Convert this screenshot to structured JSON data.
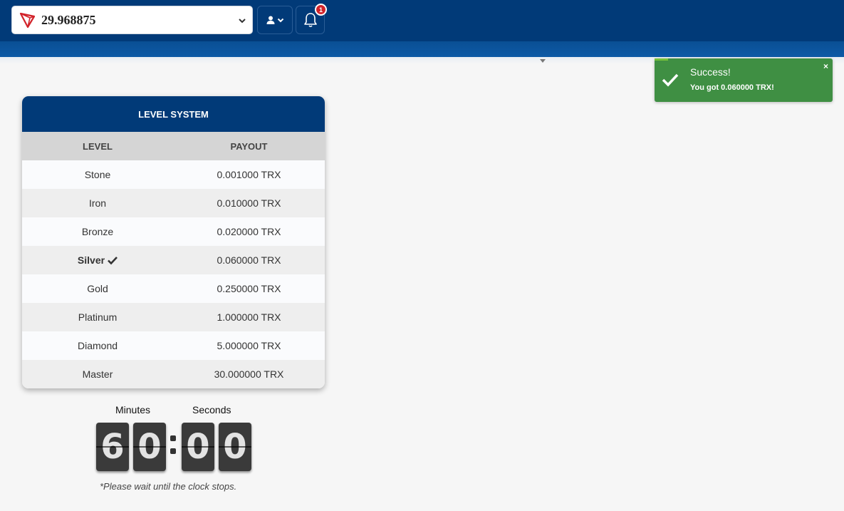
{
  "header": {
    "balance": "29.968875",
    "notification_count": "1",
    "icons": {
      "currency": "tron-icon",
      "user": "user-icon",
      "notifications": "bell-icon"
    }
  },
  "toast": {
    "title": "Success!",
    "message": "You got 0.060000 TRX!",
    "close": "×",
    "color": "#3f8f43"
  },
  "level_system": {
    "title": "LEVEL SYSTEM",
    "columns": [
      "LEVEL",
      "PAYOUT"
    ],
    "rows": [
      {
        "level": "Stone",
        "payout": "0.001000 TRX"
      },
      {
        "level": "Iron",
        "payout": "0.010000 TRX"
      },
      {
        "level": "Bronze",
        "payout": "0.020000 TRX"
      },
      {
        "level": "Silver",
        "payout": "0.060000 TRX",
        "current": true
      },
      {
        "level": "Gold",
        "payout": "0.250000 TRX"
      },
      {
        "level": "Platinum",
        "payout": "1.000000 TRX"
      },
      {
        "level": "Diamond",
        "payout": "5.000000 TRX"
      },
      {
        "level": "Master",
        "payout": "30.000000 TRX"
      }
    ]
  },
  "timer": {
    "minutes_label": "Minutes",
    "seconds_label": "Seconds",
    "digits": [
      "6",
      "0",
      "0",
      "0"
    ],
    "note": "*Please wait until the clock stops."
  },
  "colors": {
    "brand": "#013a78",
    "accent": "#0d5aa6",
    "success": "#3f8f43",
    "badge": "#d2232a"
  }
}
